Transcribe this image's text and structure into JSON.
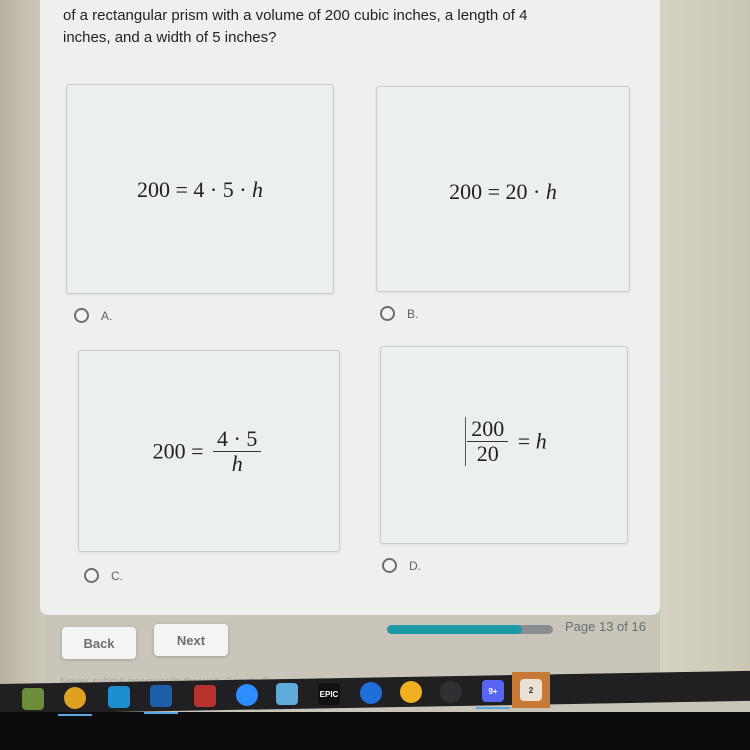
{
  "question": {
    "line1": "of a rectangular prism with a volume of 200 cubic inches, a length of 4",
    "line2": "inches, and a width of 5 inches?"
  },
  "options": [
    {
      "letter": "A.",
      "equation": {
        "lhs": "200",
        "op": "=",
        "rhs": "4 · 5 · ",
        "var": "h"
      },
      "selected": false
    },
    {
      "letter": "B.",
      "equation": {
        "lhs": "200",
        "op": "=",
        "rhs": "20 · ",
        "var": "h"
      },
      "selected": false
    },
    {
      "letter": "C.",
      "equation": {
        "lhs": "200",
        "op": "=",
        "numerator": "4 · 5",
        "denominator": "h"
      },
      "selected": false
    },
    {
      "letter": "D.",
      "equation": {
        "numerator": "200",
        "denominator": "20",
        "op": "=",
        "var": "h"
      },
      "selected": false
    }
  ],
  "navigation": {
    "back_label": "Back",
    "next_label": "Next"
  },
  "progress": {
    "current_page": 13,
    "total_pages": 16,
    "fraction": 0.8125,
    "label": "Page 13 of 16",
    "fill_color": "#1a9aa6",
    "track_color": "#8a8d90"
  },
  "footer": {
    "note": "Never submit passwords through Google Forms."
  },
  "taskbar": {
    "icons": [
      {
        "name": "minecraft-icon",
        "glyph": "",
        "color": "#6b8e3a"
      },
      {
        "name": "chrome-icon",
        "glyph": "",
        "color": "#e0a020",
        "active": true
      },
      {
        "name": "amazon-icon",
        "glyph": "",
        "color": "#1d8fd0"
      },
      {
        "name": "steam-icon",
        "glyph": "",
        "color": "#1b5fa8",
        "active": true
      },
      {
        "name": "winrar-icon",
        "glyph": "",
        "color": "#b8322e"
      },
      {
        "name": "zoom-icon",
        "glyph": "",
        "color": "#2d8cff"
      },
      {
        "name": "photos-icon",
        "glyph": "",
        "color": "#5eaad8"
      },
      {
        "name": "epic-games-icon",
        "glyph": "EPIC",
        "color": "#111111"
      },
      {
        "name": "app-blue-circle-icon",
        "glyph": "",
        "color": "#1e6fd9"
      },
      {
        "name": "weather-icon",
        "glyph": "",
        "color": "#f0b020"
      },
      {
        "name": "obs-icon",
        "glyph": "",
        "color": "#303034"
      },
      {
        "name": "discord-icon",
        "glyph": "9+",
        "color": "#5865f2",
        "active": true
      },
      {
        "name": "xbox-icon",
        "glyph": "2",
        "color": "#c77a36",
        "highlighted": true
      }
    ]
  }
}
